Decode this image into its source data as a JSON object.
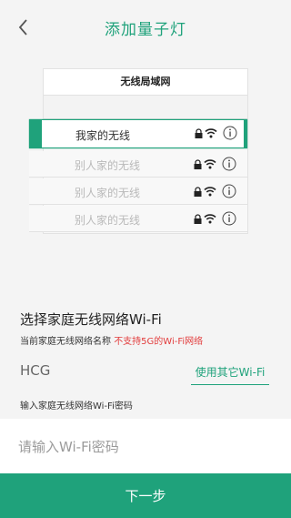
{
  "header": {
    "title": "添加量子灯"
  },
  "illustration": {
    "title": "无线局域网",
    "networks": [
      {
        "name": "我家的无线",
        "selected": true
      },
      {
        "name": "别人家的无线",
        "selected": false
      },
      {
        "name": "别人家的无线",
        "selected": false
      },
      {
        "name": "别人家的无线",
        "selected": false
      }
    ]
  },
  "form": {
    "section_title": "选择家庭无线网络Wi-Fi",
    "current_label": "当前家庭无线网络名称",
    "warning": "不支持5G的Wi-Fi网络",
    "ssid": "HCG",
    "other_wifi": "使用其它Wi-Fi",
    "password_label": "输入家庭无线网络Wi-Fi密码",
    "password_placeholder": "请输入Wi-Fi密码",
    "next_button": "下一步"
  },
  "colors": {
    "accent": "#1fa27b",
    "warning": "#e23c3c"
  }
}
